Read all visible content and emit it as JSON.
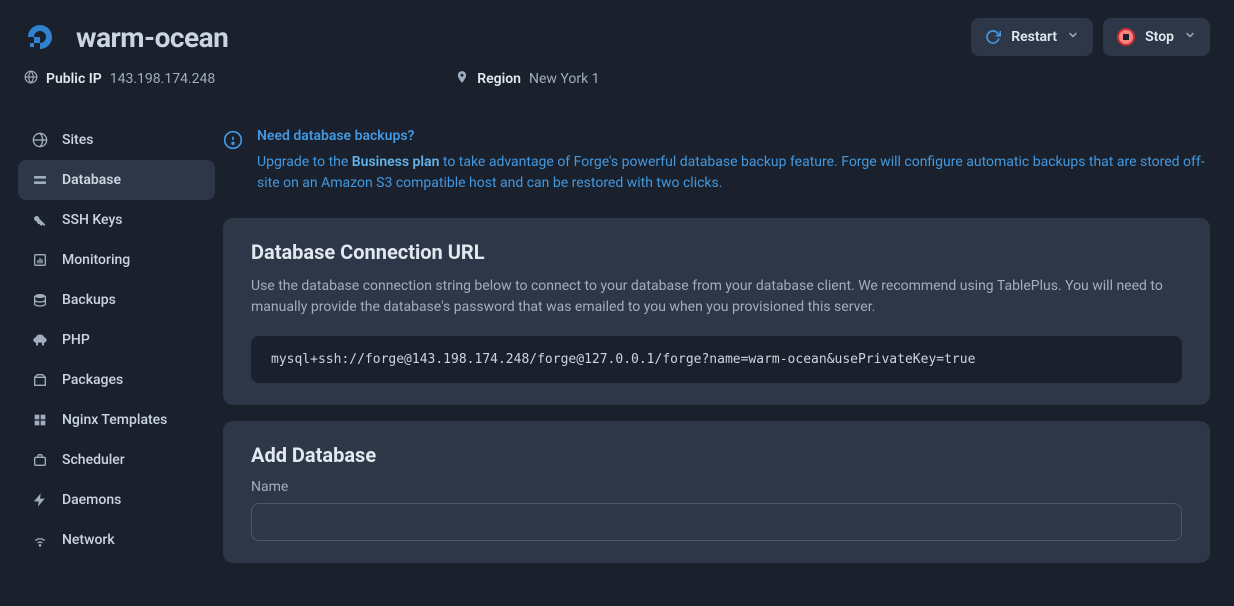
{
  "header": {
    "server_name": "warm-ocean",
    "restart_label": "Restart",
    "stop_label": "Stop"
  },
  "meta": {
    "public_ip_label": "Public IP",
    "public_ip_value": "143.198.174.248",
    "region_label": "Region",
    "region_value": "New York 1"
  },
  "sidebar": {
    "items": [
      {
        "label": "Sites",
        "icon": "globe-icon"
      },
      {
        "label": "Database",
        "icon": "database-icon"
      },
      {
        "label": "SSH Keys",
        "icon": "key-icon"
      },
      {
        "label": "Monitoring",
        "icon": "chart-icon"
      },
      {
        "label": "Backups",
        "icon": "stack-icon"
      },
      {
        "label": "PHP",
        "icon": "elephant-icon"
      },
      {
        "label": "Packages",
        "icon": "box-icon"
      },
      {
        "label": "Nginx Templates",
        "icon": "template-icon"
      },
      {
        "label": "Scheduler",
        "icon": "briefcase-icon"
      },
      {
        "label": "Daemons",
        "icon": "bolt-icon"
      },
      {
        "label": "Network",
        "icon": "wifi-icon"
      }
    ],
    "active_index": 1
  },
  "banner": {
    "title": "Need database backups?",
    "text_prefix": "Upgrade to the ",
    "link_text": "Business plan",
    "text_suffix": " to take advantage of Forge's powerful database backup feature. Forge will configure automatic backups that are stored off-site on an Amazon S3 compatible host and can be restored with two clicks."
  },
  "connection_card": {
    "title": "Database Connection URL",
    "description": "Use the database connection string below to connect to your database from your database client. We recommend using TablePlus. You will need to manually provide the database's password that was emailed to you when you provisioned this server.",
    "connection_string": "mysql+ssh://forge@143.198.174.248/forge@127.0.0.1/forge?name=warm-ocean&usePrivateKey=true"
  },
  "add_db_card": {
    "title": "Add Database",
    "name_label": "Name",
    "name_value": ""
  }
}
